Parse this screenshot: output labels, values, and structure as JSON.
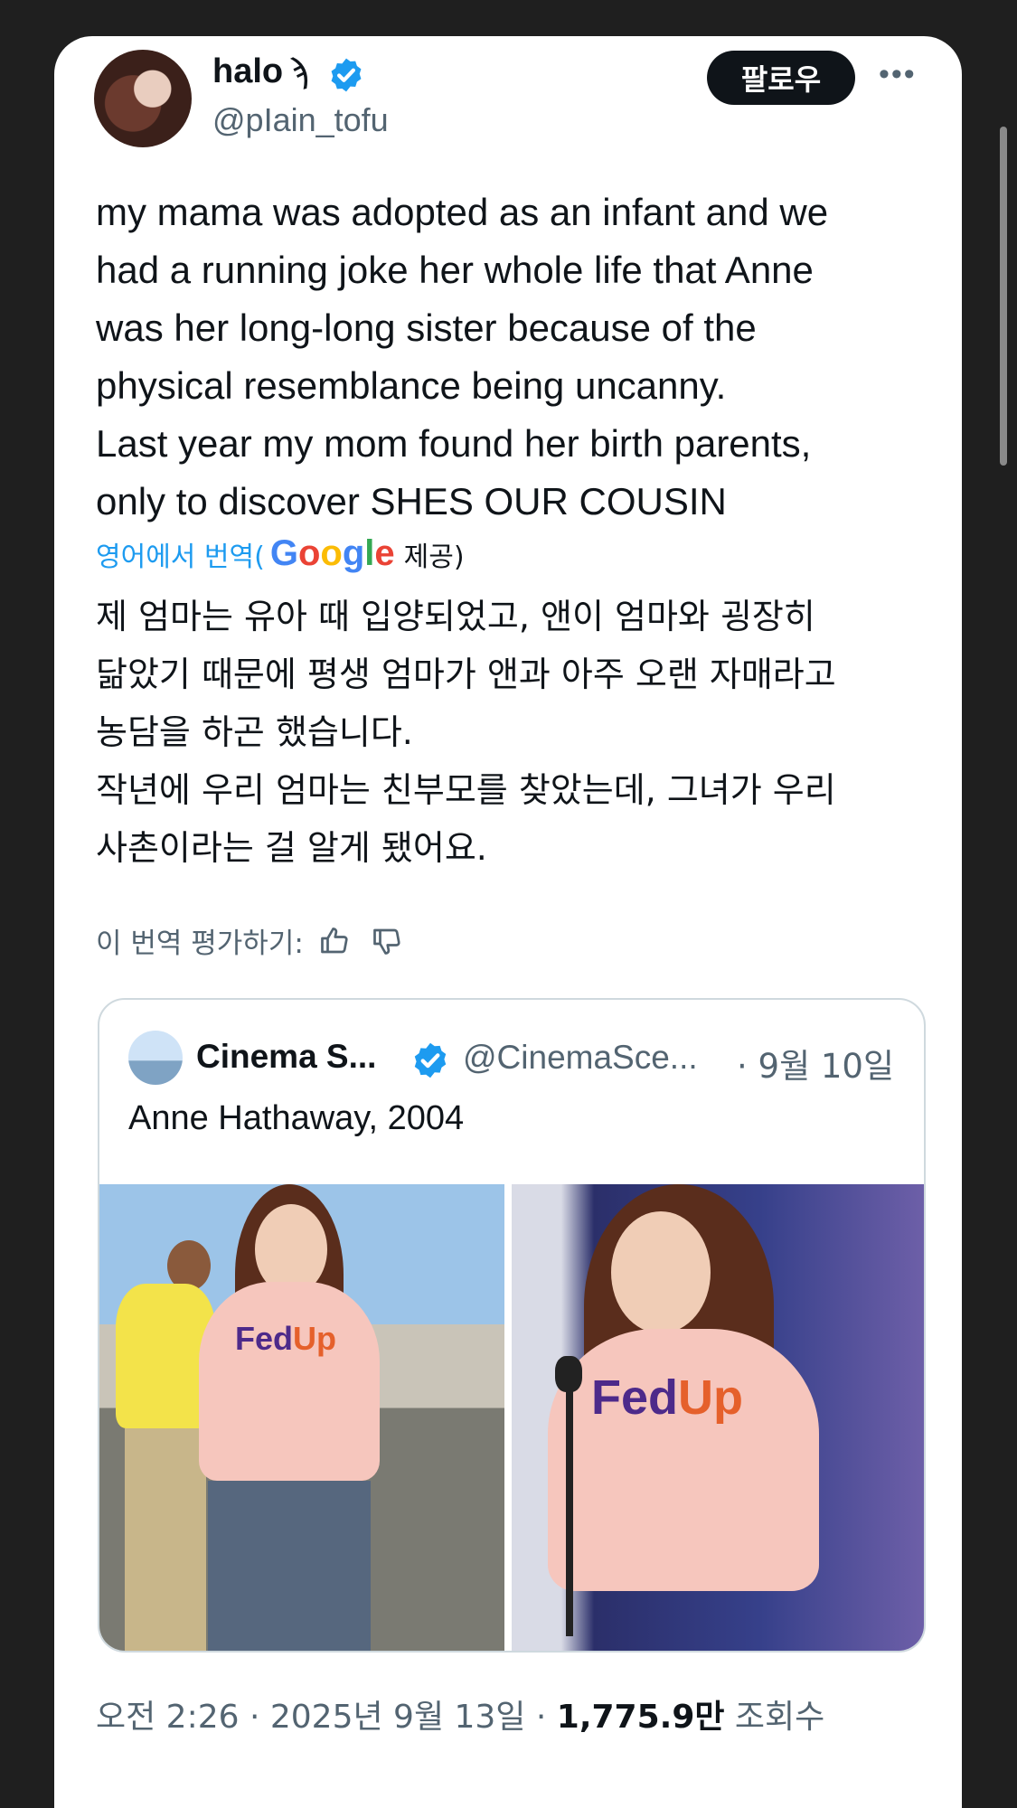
{
  "author": {
    "name": "halo",
    "name_deco": "ϡ",
    "handle": "@pIain_tofu",
    "verified_icon": "verified-badge-icon",
    "verified_color": "#1d9bf0"
  },
  "actions": {
    "follow_label": "팔로우",
    "more_label": "•••"
  },
  "tweet": {
    "text": "my mama was adopted as an infant and we\nhad a running joke her whole life that Anne\nwas her long-long sister because of the\nphysical resemblance being uncanny.\nLast year my mom found her birth parents,\nonly to discover SHES OUR COUSIN",
    "translate_prefix": "영어에서 번역(",
    "google_letters": [
      "G",
      "o",
      "o",
      "g",
      "l",
      "e"
    ],
    "translate_suffix": "제공)",
    "translated_text": "제 엄마는 유아 때 입양되었고, 앤이 엄마와 굉장히\n닮았기 때문에 평생 엄마가 앤과 아주 오랜 자매라고\n농담을 하곤 했습니다.\n작년에 우리 엄마는 친부모를 찾았는데, 그녀가 우리\n사촌이라는 걸 알게 됐어요.",
    "rate_label": "이 번역 평가하기:"
  },
  "quote": {
    "name": "Cinema S...",
    "handle": "@CinemaSce...",
    "date": "· 9월 10일",
    "text": "Anne Hathaway, 2004",
    "shirt_text_1": "Fed",
    "shirt_text_2": "Up"
  },
  "footer": {
    "time": "오전 2:26 · 2025년 9월 13일 · ",
    "views": "1,775.9만",
    "views_label": " 조회수"
  },
  "colors": {
    "accent": "#1d9bf0",
    "text": "#0f1419",
    "muted": "#536471"
  }
}
